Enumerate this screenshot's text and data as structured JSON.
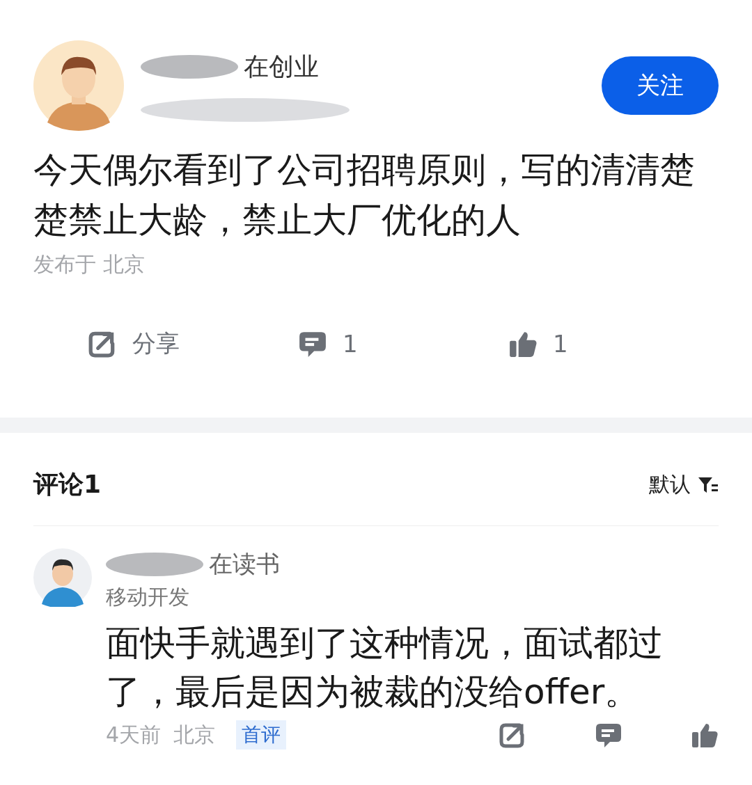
{
  "post": {
    "author": {
      "name": "在创业"
    },
    "follow_button": "关注",
    "text": "今天偶尔看到了公司招聘原则，写的清清楚楚禁止大龄，禁止大厂优化的人",
    "location": "发布于 北京",
    "actions": [
      {
        "kind": "share",
        "label": "分享"
      },
      {
        "kind": "comment",
        "label": "1"
      },
      {
        "kind": "like",
        "label": "1"
      }
    ]
  },
  "comments_section": {
    "title": "评论1",
    "sort": "默认",
    "comments": [
      {
        "name": "在读书",
        "title": "移动开发",
        "text": "面快手就遇到了这种情况，面试都过了，最后是因为被裁的没给offer。",
        "time": "4天前",
        "location": "北京",
        "badge": "首评",
        "actions": [
          {
            "kind": "share"
          },
          {
            "kind": "comment"
          },
          {
            "kind": "like"
          }
        ]
      }
    ]
  }
}
